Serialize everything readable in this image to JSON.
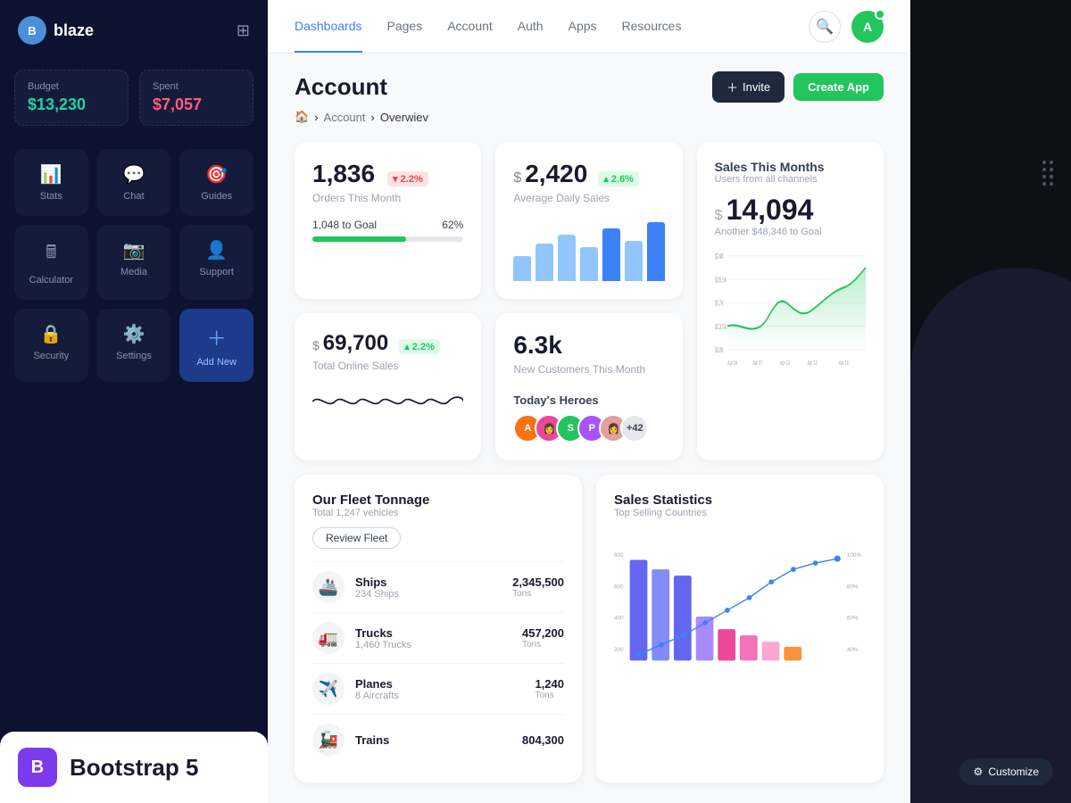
{
  "app": {
    "name": "blaze"
  },
  "sidebar": {
    "budget_label": "Budget",
    "budget_value": "$13,230",
    "spent_label": "Spent",
    "spent_value": "$7,057",
    "nav_items": [
      {
        "id": "stats",
        "label": "Stats",
        "icon": "📊"
      },
      {
        "id": "chat",
        "label": "Chat",
        "icon": "💬"
      },
      {
        "id": "guides",
        "label": "Guides",
        "icon": "🎯"
      },
      {
        "id": "calculator",
        "label": "Calculator",
        "icon": "🖩"
      },
      {
        "id": "media",
        "label": "Media",
        "icon": "📷"
      },
      {
        "id": "support",
        "label": "Support",
        "icon": "👤"
      },
      {
        "id": "security",
        "label": "Security",
        "icon": "🔒"
      },
      {
        "id": "settings",
        "label": "Settings",
        "icon": "⚙️"
      },
      {
        "id": "add-new",
        "label": "Add New",
        "icon": "+"
      }
    ],
    "bootstrap_label": "Bootstrap 5",
    "bootstrap_letter": "B"
  },
  "topnav": {
    "tabs": [
      {
        "id": "dashboards",
        "label": "Dashboards",
        "active": true
      },
      {
        "id": "pages",
        "label": "Pages"
      },
      {
        "id": "account",
        "label": "Account"
      },
      {
        "id": "auth",
        "label": "Auth"
      },
      {
        "id": "apps",
        "label": "Apps"
      },
      {
        "id": "resources",
        "label": "Resources"
      }
    ]
  },
  "breadcrumb": {
    "home": "🏠",
    "section": "Account",
    "current": "Overwiev"
  },
  "page": {
    "title": "Account",
    "invite_label": "Invite",
    "create_app_label": "Create App"
  },
  "stats": {
    "orders": {
      "value": "1,836",
      "badge": "▾ 2.2%",
      "badge_type": "red",
      "label": "Orders This Month",
      "goal_text": "1,048 to Goal",
      "goal_pct": "62%",
      "progress": 62
    },
    "daily_sales": {
      "dollar": "$",
      "value": "2,420",
      "badge": "▴ 2.6%",
      "badge_type": "green",
      "label": "Average Daily Sales"
    },
    "sales_month": {
      "title": "Sales This Months",
      "subtitle": "Users from all channels",
      "dollar": "$",
      "value": "14,094",
      "sub": "Another $48,346 to Goal",
      "y_labels": [
        "$24K",
        "$20.5K",
        "$17K",
        "$13.5K",
        "$10K"
      ],
      "x_labels": [
        "Apr 04",
        "Apr 07",
        "Apr 10",
        "Apr 13",
        "Apr 16"
      ]
    },
    "online_sales": {
      "dollar": "$",
      "value": "69,700",
      "badge": "▴ 2.2%",
      "badge_type": "green",
      "label": "Total Online Sales"
    },
    "new_customers": {
      "value": "6.3k",
      "label": "New Customers This Month"
    },
    "heroes": {
      "title": "Today's Heroes",
      "count": "+42"
    }
  },
  "fleet": {
    "title": "Our Fleet Tonnage",
    "subtitle": "Total 1,247 vehicles",
    "review_label": "Review Fleet",
    "items": [
      {
        "icon": "🚢",
        "name": "Ships",
        "count": "234 Ships",
        "value": "2,345,500",
        "unit": "Tons"
      },
      {
        "icon": "🚛",
        "name": "Trucks",
        "count": "1,460 Trucks",
        "value": "457,200",
        "unit": "Tons"
      },
      {
        "icon": "✈️",
        "name": "Planes",
        "count": "8 Aircrafts",
        "value": "1,240",
        "unit": "Tons"
      },
      {
        "icon": "🚂",
        "name": "Trains",
        "count": "",
        "value": "804,300",
        "unit": ""
      }
    ]
  },
  "sales_stats": {
    "title": "Sales Statistics",
    "subtitle": "Top Selling Countries",
    "y_labels": [
      "800",
      "600",
      "400",
      "200"
    ],
    "pct_labels": [
      "100%",
      "80%",
      "60%",
      "40%"
    ]
  },
  "customize_label": "Customize"
}
